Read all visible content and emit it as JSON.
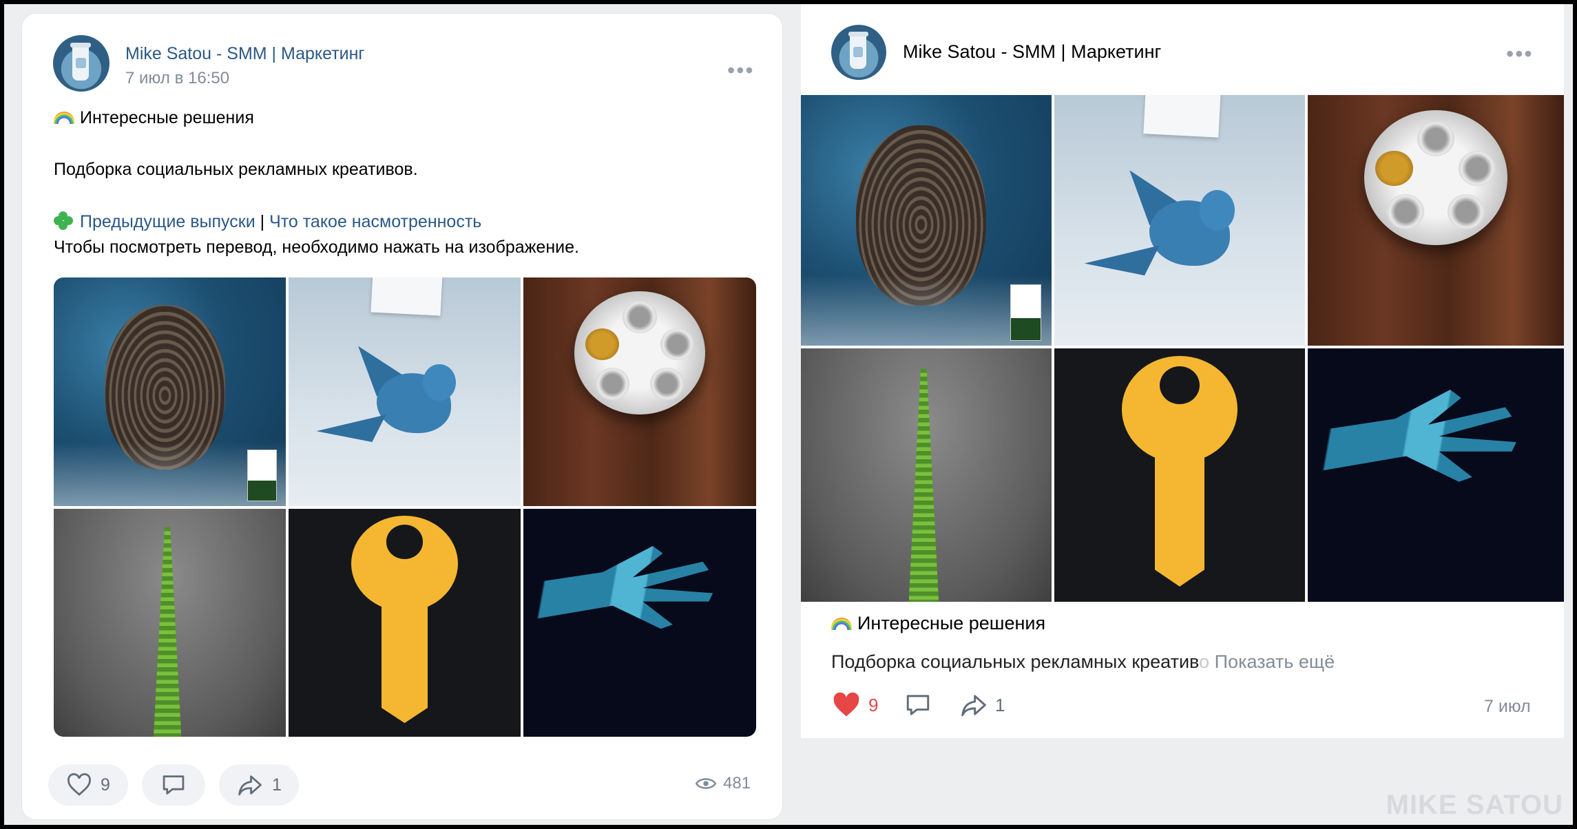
{
  "left_post": {
    "author": "Mike Satou - SMM | Маркетинг",
    "date": "7 июл в 16:50",
    "more": "•••",
    "heading": "Интересные решения",
    "subtitle": "Подборка социальных рекламных креативов.",
    "link_previous": "Предыдущие выпуски",
    "separator": "|",
    "link_what": "Что такое насмотренность",
    "note": "Чтобы посмотреть перевод, необходимо нажать на изображение.",
    "likes": "9",
    "reposts": "1",
    "views": "481"
  },
  "right_post": {
    "author": "Mike Satou - SMM | Маркетинг",
    "more": "•••",
    "heading": "Интересные решения",
    "subtitle": "Подборка социальных рекламных креатив",
    "subtitle_fade": "о",
    "show_more": "Показать ещё",
    "likes": "9",
    "reposts": "1",
    "date": "7 июл"
  },
  "images": [
    {
      "icon": "fingerprint-image"
    },
    {
      "icon": "broken-bird-image"
    },
    {
      "icon": "plate-image"
    },
    {
      "icon": "plant-road-image"
    },
    {
      "icon": "key-image"
    },
    {
      "icon": "xray-hand-image"
    }
  ],
  "colors": {
    "link": "#2a5885",
    "like_red": "#e64646",
    "muted": "#818c99",
    "background": "#edeef0"
  },
  "watermark": "MIKE SATOU"
}
